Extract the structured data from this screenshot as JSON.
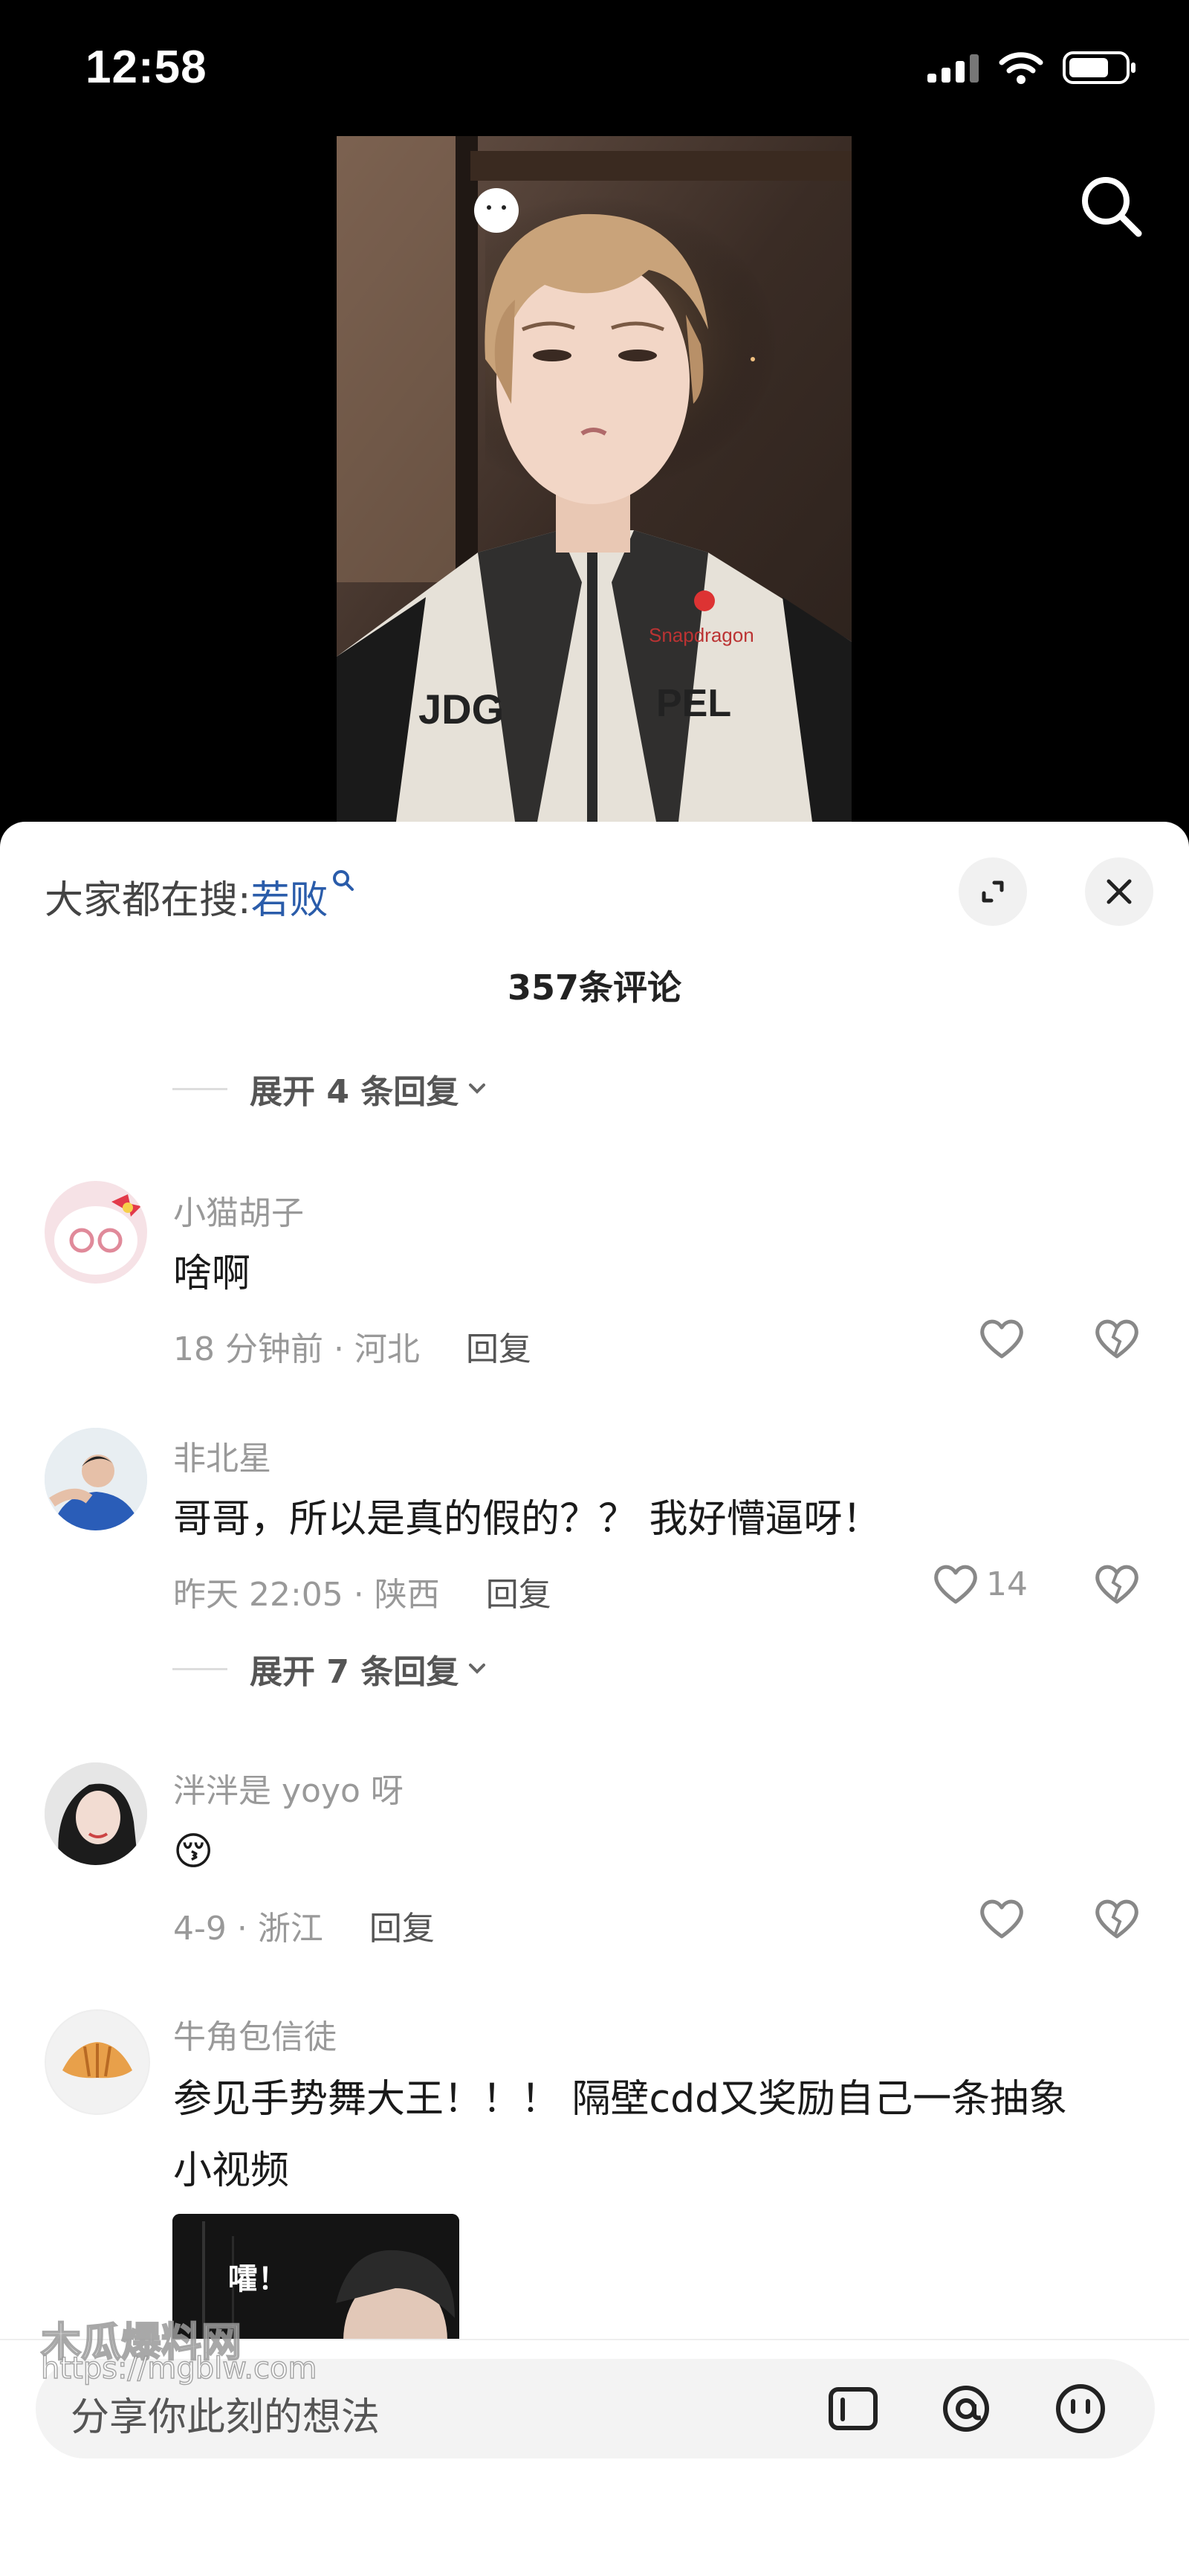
{
  "status_bar": {
    "time": "12:58"
  },
  "hot_search": {
    "prefix": "大家都在搜:",
    "keyword": "若败"
  },
  "comments_header": {
    "count_label": "357条评论"
  },
  "expand_top": {
    "label": "展开 4 条回复"
  },
  "comments": [
    {
      "username": "小猫胡子",
      "text": "啥啊",
      "time_location": "18 分钟前 · 河北",
      "reply_label": "回复",
      "like_count": ""
    },
    {
      "username": "非北星",
      "text": "哥哥，所以是真的假的？？ 我好懵逼呀！",
      "time_location": "昨天 22:05 · 陕西",
      "reply_label": "回复",
      "like_count": "14"
    },
    {
      "username": "泮泮是 yoyo 呀",
      "text": "😚",
      "time_location": "4-9 · 浙江",
      "reply_label": "回复",
      "like_count": ""
    },
    {
      "username": "牛角包信徒",
      "text_line1": "参见手势舞大王！！！ 隔壁cdd又奖励自己一条抽象",
      "text_line2": "小视频",
      "thumbnail_caption": "嚯！"
    }
  ],
  "expand_mid": {
    "label": "展开 7 条回复"
  },
  "composer": {
    "placeholder": "分享你此刻的想法"
  },
  "watermark": {
    "line1": "木瓜爆料网",
    "line2": "https://mgblw.com"
  },
  "colors": {
    "keyword": "#2a5caa",
    "sheet_bg": "#ffffff",
    "page_bg": "#000000"
  }
}
